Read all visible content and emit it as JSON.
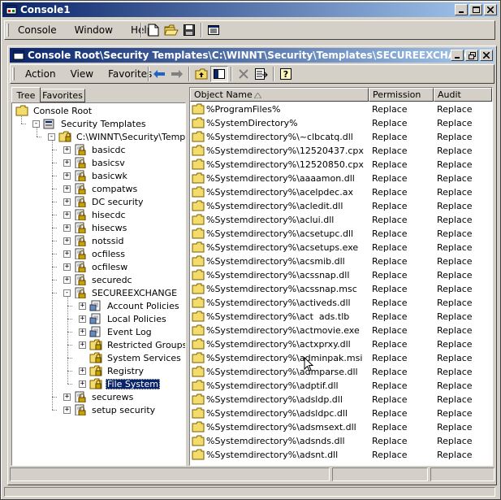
{
  "outer": {
    "title": "Console1"
  },
  "outer_menu": [
    {
      "label": "Console",
      "u": "C"
    },
    {
      "label": "Window",
      "u": "W"
    },
    {
      "label": "Help",
      "u": "H"
    }
  ],
  "inner": {
    "title": "Console Root\\Security Templates\\C:\\WINNT\\Security\\Templates\\SECUREEXCHANGE\\File Syste..."
  },
  "inner_menu": [
    {
      "label": "Action"
    },
    {
      "label": "View"
    },
    {
      "label": "Favorites"
    }
  ],
  "tabs": {
    "tree": "Tree",
    "favorites": "Favorites"
  },
  "tree": [
    {
      "label": "Console Root",
      "level": 0,
      "expander": "",
      "icon": "folder-icon"
    },
    {
      "label": "Security Templates",
      "level": 1,
      "expander": "-",
      "icon": "security-templates-icon"
    },
    {
      "label": "C:\\WINNT\\Security\\Templates",
      "level": 2,
      "expander": "-",
      "icon": "template-folder-icon"
    },
    {
      "label": "basicdc",
      "level": 3,
      "expander": "+",
      "icon": "template-icon"
    },
    {
      "label": "basicsv",
      "level": 3,
      "expander": "+",
      "icon": "template-icon"
    },
    {
      "label": "basicwk",
      "level": 3,
      "expander": "+",
      "icon": "template-icon"
    },
    {
      "label": "compatws",
      "level": 3,
      "expander": "+",
      "icon": "template-icon"
    },
    {
      "label": "DC security",
      "level": 3,
      "expander": "+",
      "icon": "template-icon"
    },
    {
      "label": "hisecdc",
      "level": 3,
      "expander": "+",
      "icon": "template-icon"
    },
    {
      "label": "hisecws",
      "level": 3,
      "expander": "+",
      "icon": "template-icon"
    },
    {
      "label": "notssid",
      "level": 3,
      "expander": "+",
      "icon": "template-icon"
    },
    {
      "label": "ocfiless",
      "level": 3,
      "expander": "+",
      "icon": "template-icon"
    },
    {
      "label": "ocfilesw",
      "level": 3,
      "expander": "+",
      "icon": "template-icon"
    },
    {
      "label": "securedc",
      "level": 3,
      "expander": "+",
      "icon": "template-icon"
    },
    {
      "label": "SECUREEXCHANGE",
      "level": 3,
      "expander": "-",
      "icon": "template-icon"
    },
    {
      "label": "Account Policies",
      "level": 4,
      "expander": "+",
      "icon": "policy-icon"
    },
    {
      "label": "Local Policies",
      "level": 4,
      "expander": "+",
      "icon": "policy-icon"
    },
    {
      "label": "Event Log",
      "level": 4,
      "expander": "+",
      "icon": "policy-icon"
    },
    {
      "label": "Restricted Groups",
      "level": 4,
      "expander": "+",
      "icon": "lock-folder-icon"
    },
    {
      "label": "System Services",
      "level": 4,
      "expander": "",
      "icon": "lock-folder-icon"
    },
    {
      "label": "Registry",
      "level": 4,
      "expander": "+",
      "icon": "lock-folder-icon"
    },
    {
      "label": "File System",
      "level": 4,
      "expander": "+",
      "icon": "lock-folder-icon",
      "selected": true
    },
    {
      "label": "securews",
      "level": 3,
      "expander": "+",
      "icon": "template-icon"
    },
    {
      "label": "setup security",
      "level": 3,
      "expander": "+",
      "icon": "template-icon"
    }
  ],
  "list": {
    "columns": [
      "Object Name",
      "Permission",
      "Audit"
    ],
    "rows": [
      [
        "%ProgramFiles%",
        "Replace",
        "Replace"
      ],
      [
        "%SystemDirectory%",
        "Replace",
        "Replace"
      ],
      [
        "%Systemdirectory%\\~clbcatq.dll",
        "Replace",
        "Replace"
      ],
      [
        "%Systemdirectory%\\12520437.cpx",
        "Replace",
        "Replace"
      ],
      [
        "%Systemdirectory%\\12520850.cpx",
        "Replace",
        "Replace"
      ],
      [
        "%Systemdirectory%\\aaaamon.dll",
        "Replace",
        "Replace"
      ],
      [
        "%Systemdirectory%\\acelpdec.ax",
        "Replace",
        "Replace"
      ],
      [
        "%Systemdirectory%\\acledit.dll",
        "Replace",
        "Replace"
      ],
      [
        "%Systemdirectory%\\aclui.dll",
        "Replace",
        "Replace"
      ],
      [
        "%Systemdirectory%\\acsetupc.dll",
        "Replace",
        "Replace"
      ],
      [
        "%Systemdirectory%\\acsetups.exe",
        "Replace",
        "Replace"
      ],
      [
        "%Systemdirectory%\\acsmib.dll",
        "Replace",
        "Replace"
      ],
      [
        "%Systemdirectory%\\acssnap.dll",
        "Replace",
        "Replace"
      ],
      [
        "%Systemdirectory%\\acssnap.msc",
        "Replace",
        "Replace"
      ],
      [
        "%Systemdirectory%\\activeds.dll",
        "Replace",
        "Replace"
      ],
      [
        "%Systemdirectory%\\act  ads.tlb",
        "Replace",
        "Replace"
      ],
      [
        "%Systemdirectory%\\actmovie.exe",
        "Replace",
        "Replace"
      ],
      [
        "%Systemdirectory%\\actxprxy.dll",
        "Replace",
        "Replace"
      ],
      [
        "%Systemdirectory%\\adminpak.msi",
        "Replace",
        "Replace"
      ],
      [
        "%Systemdirectory%\\admparse.dll",
        "Replace",
        "Replace"
      ],
      [
        "%Systemdirectory%\\adptif.dll",
        "Replace",
        "Replace"
      ],
      [
        "%Systemdirectory%\\adsldp.dll",
        "Replace",
        "Replace"
      ],
      [
        "%Systemdirectory%\\adsldpc.dll",
        "Replace",
        "Replace"
      ],
      [
        "%Systemdirectory%\\adsmsext.dll",
        "Replace",
        "Replace"
      ],
      [
        "%Systemdirectory%\\adsnds.dll",
        "Replace",
        "Replace"
      ],
      [
        "%Systemdirectory%\\adsnt.dll",
        "Replace",
        "Replace"
      ]
    ]
  },
  "colors": {
    "title_active": "#0a246a",
    "title_gradient": "#a6caf0",
    "face": "#d4d0c8",
    "selection": "#0a246a"
  }
}
